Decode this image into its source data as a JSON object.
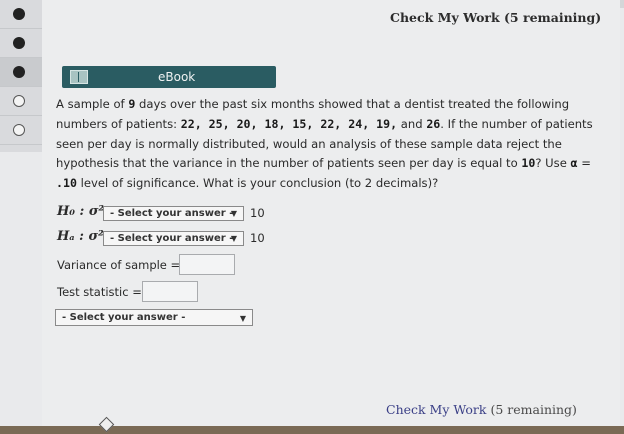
{
  "header": {
    "check_my_work": "Check My Work (5 remaining)"
  },
  "sidebar": {
    "items": [
      {
        "state": "filled"
      },
      {
        "state": "filled"
      },
      {
        "state": "filled"
      },
      {
        "state": "open"
      },
      {
        "state": "open"
      }
    ]
  },
  "ebook": {
    "label": "eBook",
    "icon": "book-icon"
  },
  "problem": {
    "p1": "A sample of ",
    "n_days": "9",
    "p2": " days over the past six months showed that a dentist treated the following numbers of patients: ",
    "data_values": "22, 25, 20, 18, 15, 22, 24, 19,",
    "p3": " and ",
    "last_value": "26",
    "p4": ". If the number of patients seen per day is normally distributed, would an analysis of these sample data reject the hypothesis that the variance in the number of patients seen per day is equal to ",
    "hyp_value": "10",
    "p5": "? Use ",
    "alpha_symbol": "α",
    "p6": " = ",
    "alpha_value": ".10",
    "p7": " level of significance. What is your conclusion (to 2 decimals)?"
  },
  "h0": {
    "label": "H₀ : σ²",
    "select": "- Select your answer -",
    "value": "10"
  },
  "ha": {
    "label": "Hₐ : σ²",
    "select": "- Select your answer -",
    "value": "10"
  },
  "variance": {
    "label": "Variance of sample =",
    "value": ""
  },
  "test_stat": {
    "label": "Test statistic =",
    "value": ""
  },
  "conclusion": {
    "select": "- Select your answer -"
  },
  "footer": {
    "check_link": "Check My Work",
    "remaining": "(5 remaining)"
  }
}
